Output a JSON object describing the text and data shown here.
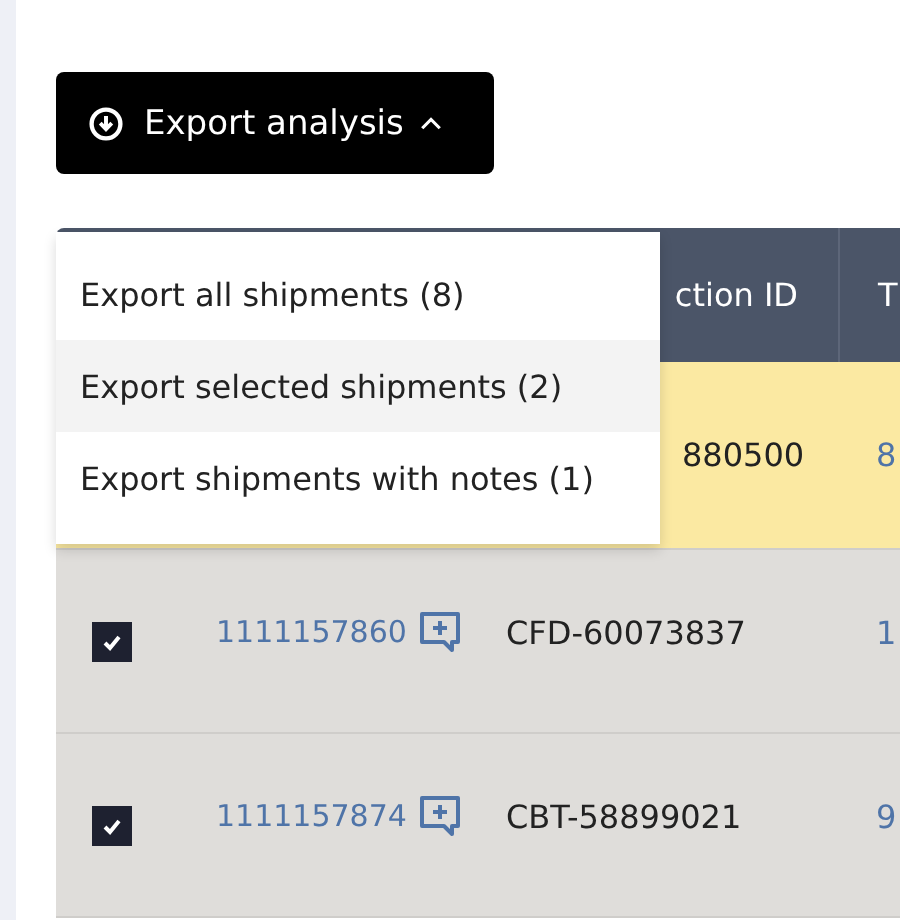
{
  "export_button": {
    "label": "Export analysis"
  },
  "export_menu": {
    "items": [
      {
        "label": "Export all shipments (8)",
        "selected": false
      },
      {
        "label": "Export selected shipments (2)",
        "selected": true
      },
      {
        "label": "Export shipments with notes (1)",
        "selected": false
      }
    ]
  },
  "table": {
    "columns": {
      "column_3": "ction ID",
      "column_4": "T"
    },
    "rows": [
      {
        "highlighted": true,
        "column_3": "880500",
        "column_4": "8"
      },
      {
        "highlighted": false,
        "checked": true,
        "shipment_id": "1111157860",
        "column_3": "CFD-60073837",
        "column_4": "1"
      },
      {
        "highlighted": false,
        "checked": true,
        "shipment_id": "1111157874",
        "column_3": "CBT-58899021",
        "column_4": "9"
      }
    ]
  }
}
